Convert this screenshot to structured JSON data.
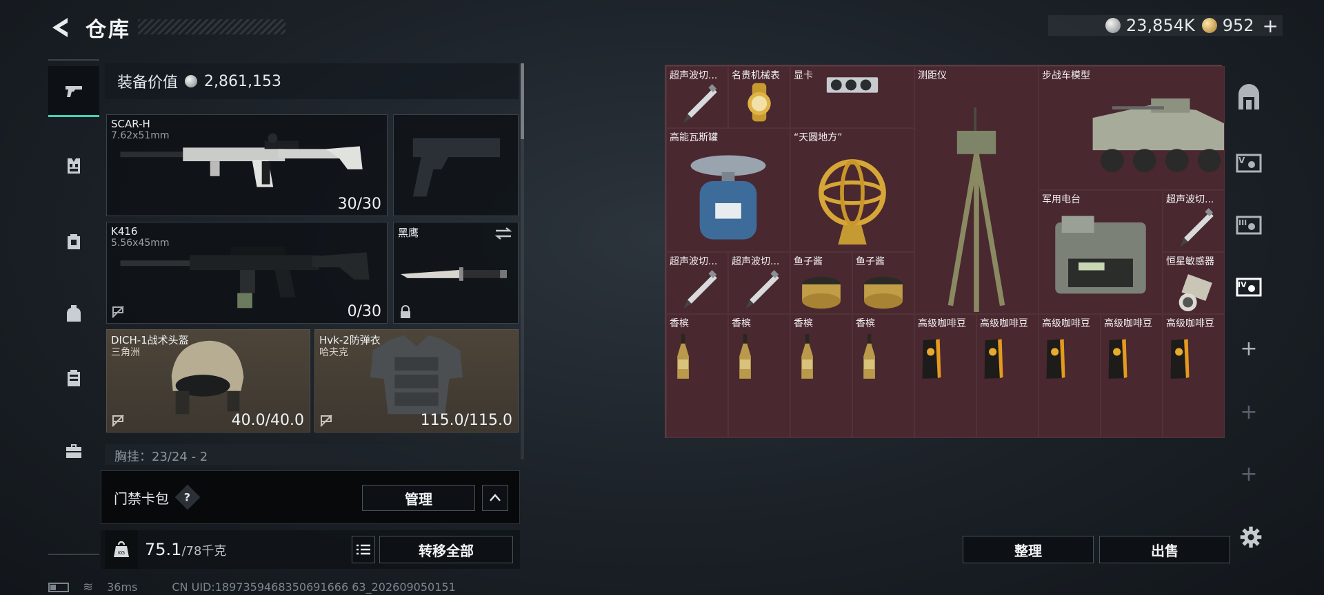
{
  "header": {
    "title": "仓库",
    "currencies": [
      {
        "icon": "silver-coin-icon",
        "value": "23,854K"
      },
      {
        "icon": "gold-coin-icon",
        "value": "952"
      }
    ],
    "add_label": "+"
  },
  "left_tabs": [
    {
      "icon": "pistol-icon",
      "active": true
    },
    {
      "icon": "chest-rig-icon",
      "active": false
    },
    {
      "icon": "backpack-slot-icon",
      "active": false
    },
    {
      "icon": "backpack-icon",
      "active": false
    },
    {
      "icon": "container-icon",
      "active": false
    },
    {
      "icon": "toolbox-icon",
      "active": false
    }
  ],
  "equipment": {
    "value_label": "装备价值",
    "value": "2,861,153",
    "primary_weapon": {
      "name": "SCAR-H",
      "caliber": "7.62x51mm",
      "ammo": "30/30"
    },
    "secondary_weapon": {
      "name": "K416",
      "caliber": "5.56x45mm",
      "ammo": "0/30"
    },
    "melee": {
      "name": "黑鹰"
    },
    "helmet": {
      "name": "DICH-1战术头盔",
      "maker": "三角洲",
      "durability": "40.0/40.0"
    },
    "armor": {
      "name": "Hvk-2防弹衣",
      "maker": "哈夫克",
      "durability": "115.0/115.0"
    },
    "chest_rig_partial": "胸挂：23/24 - 2",
    "card_bag_label": "门禁卡包",
    "help_label": "?",
    "manage_label": "管理",
    "weight_value": "75.1",
    "weight_max": "/78千克",
    "weight_icon_label": "KG",
    "transfer_all_label": "转移全部"
  },
  "grid": {
    "items": [
      {
        "name": "超声波切...",
        "art": "pen"
      },
      {
        "name": "名贵机械表",
        "art": "watch"
      },
      {
        "name": "显卡",
        "art": "gpu"
      },
      {
        "name": "测距仪",
        "art": "tripod"
      },
      {
        "name": "步战车模型",
        "art": "ifv"
      },
      {
        "name": "高能瓦斯罐",
        "art": "gas"
      },
      {
        "name": "“天圆地方”",
        "art": "armillary"
      },
      {
        "name": "军用电台",
        "art": "radio"
      },
      {
        "name": "超声波切...",
        "art": "pen"
      },
      {
        "name": "超声波切...",
        "art": "pen"
      },
      {
        "name": "超声波切...",
        "art": "pen"
      },
      {
        "name": "鱼子酱",
        "art": "caviar"
      },
      {
        "name": "鱼子酱",
        "art": "caviar"
      },
      {
        "name": "恒星敏感器",
        "art": "sensor"
      },
      {
        "name": "香槟",
        "art": "champagne"
      },
      {
        "name": "香槟",
        "art": "champagne"
      },
      {
        "name": "香槟",
        "art": "champagne"
      },
      {
        "name": "香槟",
        "art": "champagne"
      },
      {
        "name": "高级咖啡豆",
        "art": "coffee"
      },
      {
        "name": "高级咖啡豆",
        "art": "coffee"
      },
      {
        "name": "高级咖啡豆",
        "art": "coffee"
      },
      {
        "name": "高级咖啡豆",
        "art": "coffee"
      },
      {
        "name": "高级咖啡豆",
        "art": "coffee"
      }
    ],
    "sort_label": "整理",
    "sell_label": "出售"
  },
  "right_tabs": [
    {
      "icon": "storage-arch-icon"
    },
    {
      "icon": "warehouse-v-icon"
    },
    {
      "icon": "warehouse-iii-icon"
    },
    {
      "icon": "warehouse-iv-icon"
    },
    {
      "icon": "add-page-icon",
      "label": "+"
    },
    {
      "icon": "add-page-icon",
      "label": "+"
    },
    {
      "icon": "add-page-icon",
      "label": "+"
    },
    {
      "icon": "settings-gear-icon"
    }
  ],
  "footer": {
    "ping": "36ms",
    "uid": "CN UID:1897359468350691666 63_202609050151"
  },
  "colors": {
    "accent": "#3fd4b2",
    "grid_bg": "#3e2329",
    "brown_slot": "#4d4539"
  }
}
